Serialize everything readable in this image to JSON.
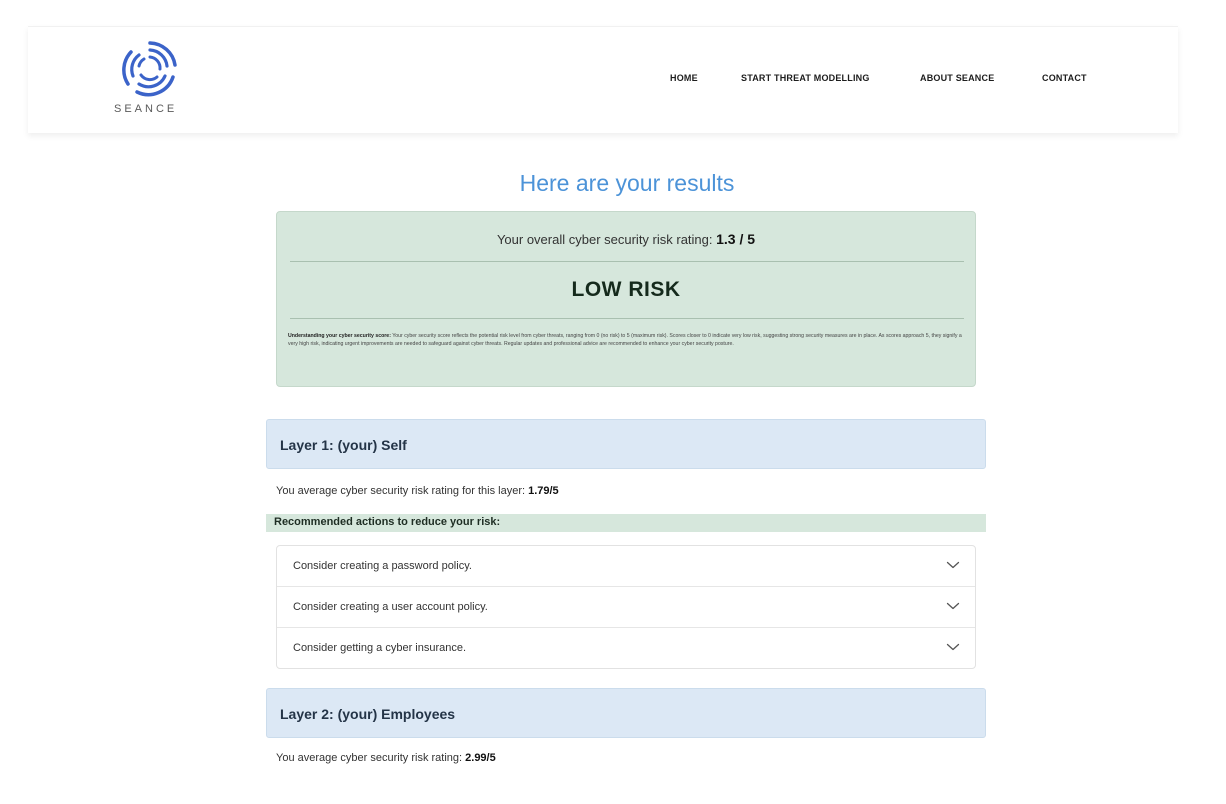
{
  "brand": {
    "name": "SEANCE"
  },
  "nav": {
    "items": [
      "HOME",
      "START THREAT MODELLING",
      "ABOUT SEANCE",
      "CONTACT"
    ]
  },
  "results": {
    "title": "Here are your results",
    "overall_prefix": "Your overall cyber security risk rating: ",
    "overall_value": "1.3 / 5",
    "risk_level": "LOW RISK",
    "explain_heading": "Understanding your cyber security score:",
    "explain_body": " Your cyber security score reflects the potential risk level from cyber threats, ranging from 0 (no risk) to 5 (maximum risk). Scores closer to 0 indicate very low risk, suggesting strong security measures are in place. As scores approach 5, they signify a very high risk, indicating urgent improvements are needed to safeguard against cyber threats. Regular updates and professional advice are recommended to enhance your cyber security posture."
  },
  "layers": [
    {
      "title": "Layer 1: (your) Self",
      "avg_prefix": "You average cyber security risk rating for this layer: ",
      "avg_value": "1.79/5",
      "recommend_heading": "Recommended actions to reduce your risk:",
      "actions": [
        "Consider creating a password policy.",
        "Consider creating a user account policy.",
        "Consider getting a cyber insurance."
      ]
    },
    {
      "title": "Layer 2: (your) Employees",
      "avg_prefix": "You average cyber security risk rating: ",
      "avg_value": "2.99/5"
    }
  ],
  "colors": {
    "accent_blue": "#4c93d8",
    "score_card_bg": "#d6e7dc",
    "layer_header_bg": "#dce8f5"
  },
  "icons": {
    "logo": "seance-logo-rings",
    "accordion": "chevron-down-icon"
  }
}
